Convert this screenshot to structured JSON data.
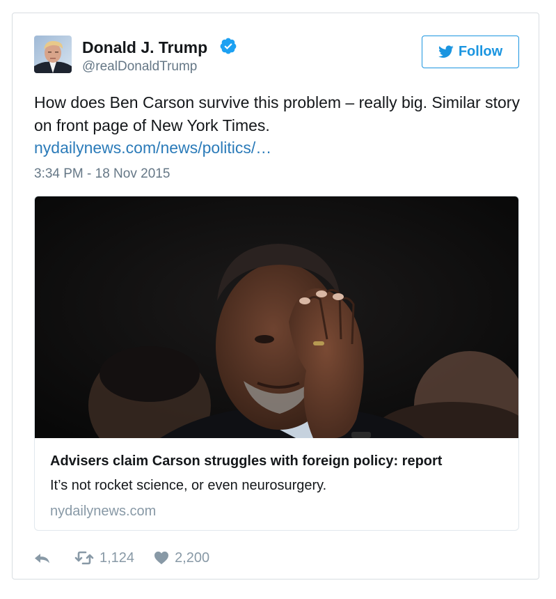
{
  "author": {
    "display_name": "Donald J. Trump",
    "handle": "@realDonaldTrump",
    "verified_icon": "verified-badge-icon",
    "avatar_icon": "avatar"
  },
  "follow_button": {
    "label": "Follow",
    "icon": "bird-icon"
  },
  "tweet": {
    "text": "How does Ben Carson survive this problem – really big. Similar story on front page of New York Times.",
    "link": "nydailynews.com/news/politics/…",
    "timestamp": "3:34 PM - 18 Nov 2015"
  },
  "card": {
    "title": "Advisers claim Carson struggles with foreign policy: report",
    "description": "It’s not rocket science, or even neurosurgery.",
    "domain": "nydailynews.com"
  },
  "actions": {
    "reply_icon": "reply-icon",
    "retweet_icon": "retweet-icon",
    "retweets": "1,124",
    "like_icon": "heart-icon",
    "likes": "2,200"
  },
  "colors": {
    "accent": "#1b95e0",
    "link": "#2b7bb9",
    "muted": "#657786",
    "action_grey": "#8899a6",
    "border": "#d8dde1"
  }
}
